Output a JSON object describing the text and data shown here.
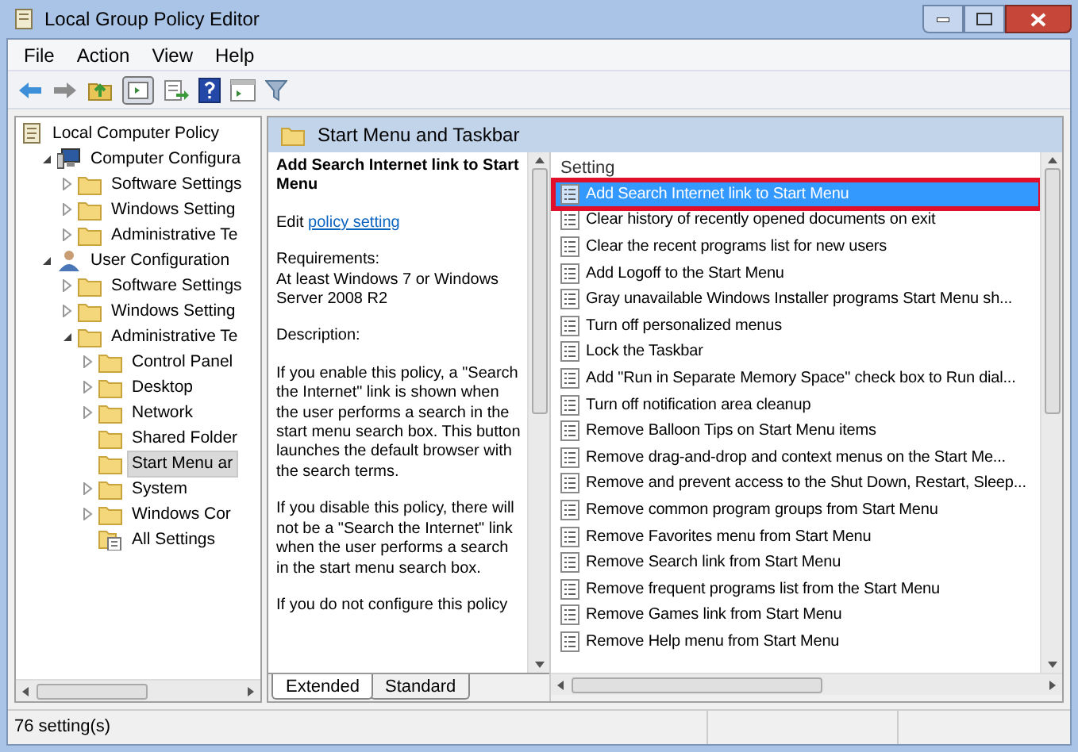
{
  "window": {
    "title": "Local Group Policy Editor"
  },
  "menu": [
    "File",
    "Action",
    "View",
    "Help"
  ],
  "tree": [
    {
      "label": "Local Computer Policy",
      "kind": "policy",
      "selected": false,
      "children": [
        {
          "label": "Computer Configura",
          "kind": "computer",
          "expandable": true,
          "expanded": true,
          "selected": false,
          "children": [
            {
              "label": "Software Settings",
              "kind": "folder",
              "expandable": true,
              "expanded": false,
              "selected": false
            },
            {
              "label": "Windows Setting",
              "kind": "folder",
              "expandable": true,
              "expanded": false,
              "selected": false
            },
            {
              "label": "Administrative Te",
              "kind": "folder",
              "expandable": true,
              "expanded": false,
              "selected": false
            }
          ]
        },
        {
          "label": "User Configuration",
          "kind": "user",
          "expandable": true,
          "expanded": true,
          "selected": false,
          "children": [
            {
              "label": "Software Settings",
              "kind": "folder",
              "expandable": true,
              "expanded": false,
              "selected": false
            },
            {
              "label": "Windows Setting",
              "kind": "folder",
              "expandable": true,
              "expanded": false,
              "selected": false
            },
            {
              "label": "Administrative Te",
              "kind": "folder",
              "expandable": true,
              "expanded": true,
              "selected": false,
              "children": [
                {
                  "label": "Control Panel",
                  "kind": "folder",
                  "expandable": true,
                  "expanded": false,
                  "selected": false
                },
                {
                  "label": "Desktop",
                  "kind": "folder",
                  "expandable": true,
                  "expanded": false,
                  "selected": false
                },
                {
                  "label": "Network",
                  "kind": "folder",
                  "expandable": true,
                  "expanded": false,
                  "selected": false
                },
                {
                  "label": "Shared Folder",
                  "kind": "folder",
                  "expandable": false,
                  "selected": false
                },
                {
                  "label": "Start Menu ar",
                  "kind": "folder",
                  "expandable": false,
                  "selected": true
                },
                {
                  "label": "System",
                  "kind": "folder",
                  "expandable": true,
                  "expanded": false,
                  "selected": false
                },
                {
                  "label": "Windows Cor",
                  "kind": "folder",
                  "expandable": true,
                  "expanded": false,
                  "selected": false
                },
                {
                  "label": "All Settings",
                  "kind": "settings",
                  "expandable": false,
                  "selected": false
                }
              ]
            }
          ]
        }
      ]
    }
  ],
  "header": {
    "title": "Start Menu and Taskbar"
  },
  "description": {
    "title": "Add Search Internet link to Start Menu",
    "edit_prefix": "Edit",
    "edit_link": "policy setting",
    "requirements_label": "Requirements:",
    "requirements": "At least Windows 7 or Windows Server 2008 R2",
    "description_label": "Description:",
    "paragraphs": [
      "If you enable this policy, a \"Search the Internet\" link is shown when the user performs a search in the start menu search box.  This button launches the default browser with the search terms.",
      "If you disable this policy, there will not be a \"Search the Internet\" link when the user performs a search in the start menu search box.",
      "If you do not configure this policy"
    ]
  },
  "list": {
    "column": "Setting",
    "rows": [
      {
        "label": "Add Search Internet link to Start Menu",
        "selected": true,
        "outlined": true
      },
      {
        "label": "Clear history of recently opened documents on exit",
        "selected": false,
        "outlined": false
      },
      {
        "label": "Clear the recent programs list for new users",
        "selected": false,
        "outlined": false
      },
      {
        "label": "Add Logoff to the Start Menu",
        "selected": false,
        "outlined": false
      },
      {
        "label": "Gray unavailable Windows Installer programs Start Menu sh...",
        "selected": false,
        "outlined": false
      },
      {
        "label": "Turn off personalized menus",
        "selected": false,
        "outlined": false
      },
      {
        "label": "Lock the Taskbar",
        "selected": false,
        "outlined": false
      },
      {
        "label": "Add \"Run in Separate Memory Space\" check box to Run dial...",
        "selected": false,
        "outlined": false
      },
      {
        "label": "Turn off notification area cleanup",
        "selected": false,
        "outlined": false
      },
      {
        "label": "Remove Balloon Tips on Start Menu items",
        "selected": false,
        "outlined": false
      },
      {
        "label": "Remove drag-and-drop and context menus on the Start Me...",
        "selected": false,
        "outlined": false
      },
      {
        "label": "Remove and prevent access to the Shut Down, Restart, Sleep...",
        "selected": false,
        "outlined": false
      },
      {
        "label": "Remove common program groups from Start Menu",
        "selected": false,
        "outlined": false
      },
      {
        "label": "Remove Favorites menu from Start Menu",
        "selected": false,
        "outlined": false
      },
      {
        "label": "Remove Search link from Start Menu",
        "selected": false,
        "outlined": false
      },
      {
        "label": "Remove frequent programs list from the Start Menu",
        "selected": false,
        "outlined": false
      },
      {
        "label": "Remove Games link from Start Menu",
        "selected": false,
        "outlined": false
      },
      {
        "label": "Remove Help menu from Start Menu",
        "selected": false,
        "outlined": false
      }
    ]
  },
  "tabs": [
    {
      "label": "Extended",
      "selected": true
    },
    {
      "label": "Standard",
      "selected": false
    }
  ],
  "status_bar": "76 setting(s)"
}
